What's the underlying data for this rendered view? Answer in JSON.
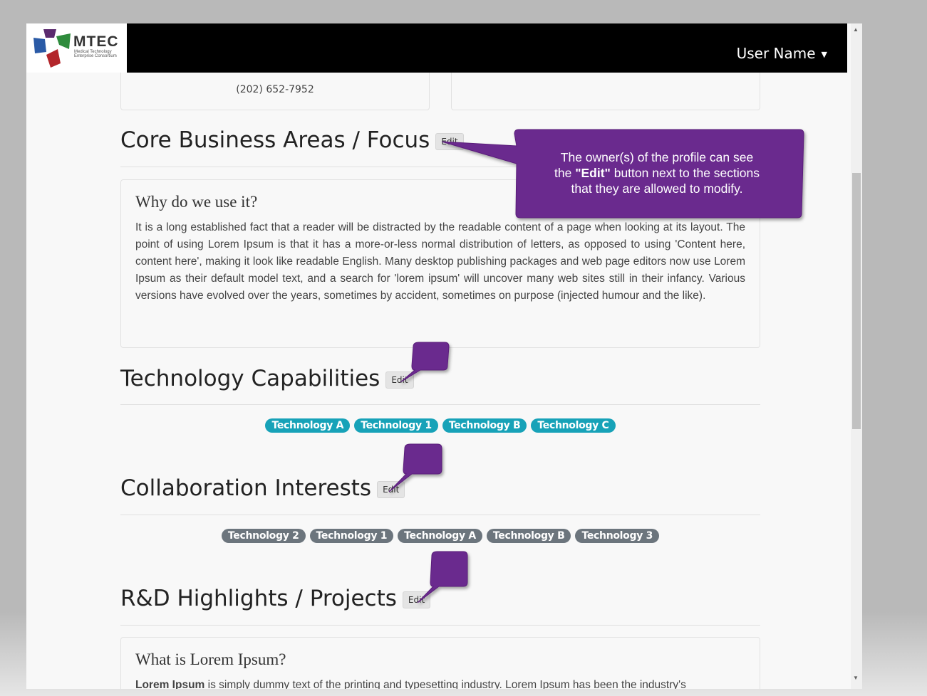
{
  "header": {
    "logo_title": "MTEC",
    "logo_subtitle": "Medical Technology Enterprise Consortium",
    "user_name": "User Name"
  },
  "contact": {
    "phone": "(202) 652-7952"
  },
  "sections": {
    "core": {
      "title": "Core Business Areas / Focus",
      "edit": "Edit",
      "card_heading": "Why do we use it?",
      "card_text": "It is a long established fact that a reader will be distracted by the readable content of a page when looking at its layout. The point of using Lorem Ipsum is that it has a more-or-less normal distribution of letters, as opposed to using 'Content here, content here', making it look like readable English. Many desktop publishing packages and web page editors now use Lorem Ipsum as their default model text, and a search for 'lorem ipsum' will uncover many web sites still in their infancy. Various versions have evolved over the years, sometimes by accident, sometimes on purpose (injected humour and the like)."
    },
    "tech": {
      "title": "Technology Capabilities",
      "edit": "Edit",
      "tags": [
        "Technology A",
        "Technology 1",
        "Technology B",
        "Technology C"
      ]
    },
    "collab": {
      "title": "Collaboration Interests",
      "edit": "Edit",
      "tags": [
        "Technology 2",
        "Technology 1",
        "Technology A",
        "Technology B",
        "Technology 3"
      ]
    },
    "rd": {
      "title": "R&D Highlights / Projects",
      "edit": "Edit",
      "card_heading": "What is Lorem Ipsum?",
      "card_bold": "Lorem Ipsum",
      "card_text": " is simply dummy text of the printing and typesetting industry. Lorem Ipsum has been the industry's"
    }
  },
  "callout": {
    "line1": "The owner(s) of the profile can see",
    "line2_pre": "the ",
    "line2_bold": "\"Edit\"",
    "line2_post": " button next to the sections",
    "line3": "that they are allowed to modify."
  },
  "colors": {
    "callout_purple": "#6a2a8e",
    "tag_teal": "#17a2b8",
    "tag_gray": "#6c757d",
    "topbar": "#000000"
  }
}
